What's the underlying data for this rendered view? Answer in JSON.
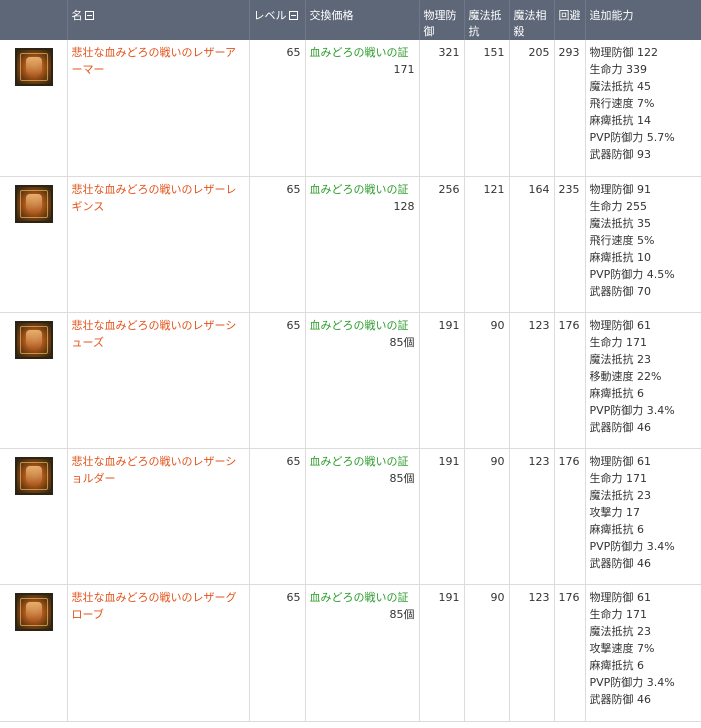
{
  "header": {
    "name": "名",
    "level": "レベル",
    "price": "交換価格",
    "phys_def": "物理防御",
    "magic_res": "魔法抵抗",
    "magic_offset": "魔法相殺",
    "evasion": "回避",
    "bonus": "追加能力"
  },
  "icon_names": [
    "armor-icon",
    "leggings-icon",
    "shoes-icon",
    "shoulder-icon",
    "gloves-icon"
  ],
  "colors": {
    "header_bg": "#5d6778",
    "item_name": "#e2531b",
    "price_name": "#2e9c2e",
    "bonus_label": "#1c8c9c"
  },
  "items": [
    {
      "name": "悲壮な血みどろの戦いのレザーアーマー",
      "level": "65",
      "price_name": "血みどろの戦いの証",
      "price_amount": "171",
      "phys_def": "321",
      "magic_res": "151",
      "magic_offset": "205",
      "evasion": "293",
      "bonus": [
        {
          "label": "物理防御",
          "value": "122"
        },
        {
          "label": "生命力",
          "value": "339"
        },
        {
          "label": "魔法抵抗",
          "value": "45"
        },
        {
          "label": "飛行速度",
          "value": "7%"
        },
        {
          "label": "麻痺抵抗",
          "value": "14"
        },
        {
          "label": "PVP防御力",
          "value": "5.7%"
        },
        {
          "label": "武器防御",
          "value": "93"
        }
      ]
    },
    {
      "name": "悲壮な血みどろの戦いのレザーレギンス",
      "level": "65",
      "price_name": "血みどろの戦いの証",
      "price_amount": "128",
      "phys_def": "256",
      "magic_res": "121",
      "magic_offset": "164",
      "evasion": "235",
      "bonus": [
        {
          "label": "物理防御",
          "value": "91"
        },
        {
          "label": "生命力",
          "value": "255"
        },
        {
          "label": "魔法抵抗",
          "value": "35"
        },
        {
          "label": "飛行速度",
          "value": "5%"
        },
        {
          "label": "麻痺抵抗",
          "value": "10"
        },
        {
          "label": "PVP防御力",
          "value": "4.5%"
        },
        {
          "label": "武器防御",
          "value": "70"
        }
      ]
    },
    {
      "name": "悲壮な血みどろの戦いのレザーシューズ",
      "level": "65",
      "price_name": "血みどろの戦いの証",
      "price_amount": "85個",
      "phys_def": "191",
      "magic_res": "90",
      "magic_offset": "123",
      "evasion": "176",
      "bonus": [
        {
          "label": "物理防御",
          "value": "61"
        },
        {
          "label": "生命力",
          "value": "171"
        },
        {
          "label": "魔法抵抗",
          "value": "23"
        },
        {
          "label": "移動速度",
          "value": "22%"
        },
        {
          "label": "麻痺抵抗",
          "value": "6"
        },
        {
          "label": "PVP防御力",
          "value": "3.4%"
        },
        {
          "label": "武器防御",
          "value": "46"
        }
      ]
    },
    {
      "name": "悲壮な血みどろの戦いのレザーショルダー",
      "level": "65",
      "price_name": "血みどろの戦いの証",
      "price_amount": "85個",
      "phys_def": "191",
      "magic_res": "90",
      "magic_offset": "123",
      "evasion": "176",
      "bonus": [
        {
          "label": "物理防御",
          "value": "61"
        },
        {
          "label": "生命力",
          "value": "171"
        },
        {
          "label": "魔法抵抗",
          "value": "23"
        },
        {
          "label": "攻撃力",
          "value": "17"
        },
        {
          "label": "麻痺抵抗",
          "value": "6"
        },
        {
          "label": "PVP防御力",
          "value": "3.4%"
        },
        {
          "label": "武器防御",
          "value": "46"
        }
      ]
    },
    {
      "name": "悲壮な血みどろの戦いのレザーグローブ",
      "level": "65",
      "price_name": "血みどろの戦いの証",
      "price_amount": "85個",
      "phys_def": "191",
      "magic_res": "90",
      "magic_offset": "123",
      "evasion": "176",
      "bonus": [
        {
          "label": "物理防御",
          "value": "61"
        },
        {
          "label": "生命力",
          "value": "171"
        },
        {
          "label": "魔法抵抗",
          "value": "23"
        },
        {
          "label": "攻撃速度",
          "value": "7%"
        },
        {
          "label": "麻痺抵抗",
          "value": "6"
        },
        {
          "label": "PVP防御力",
          "value": "3.4%"
        },
        {
          "label": "武器防御",
          "value": "46"
        }
      ]
    }
  ]
}
